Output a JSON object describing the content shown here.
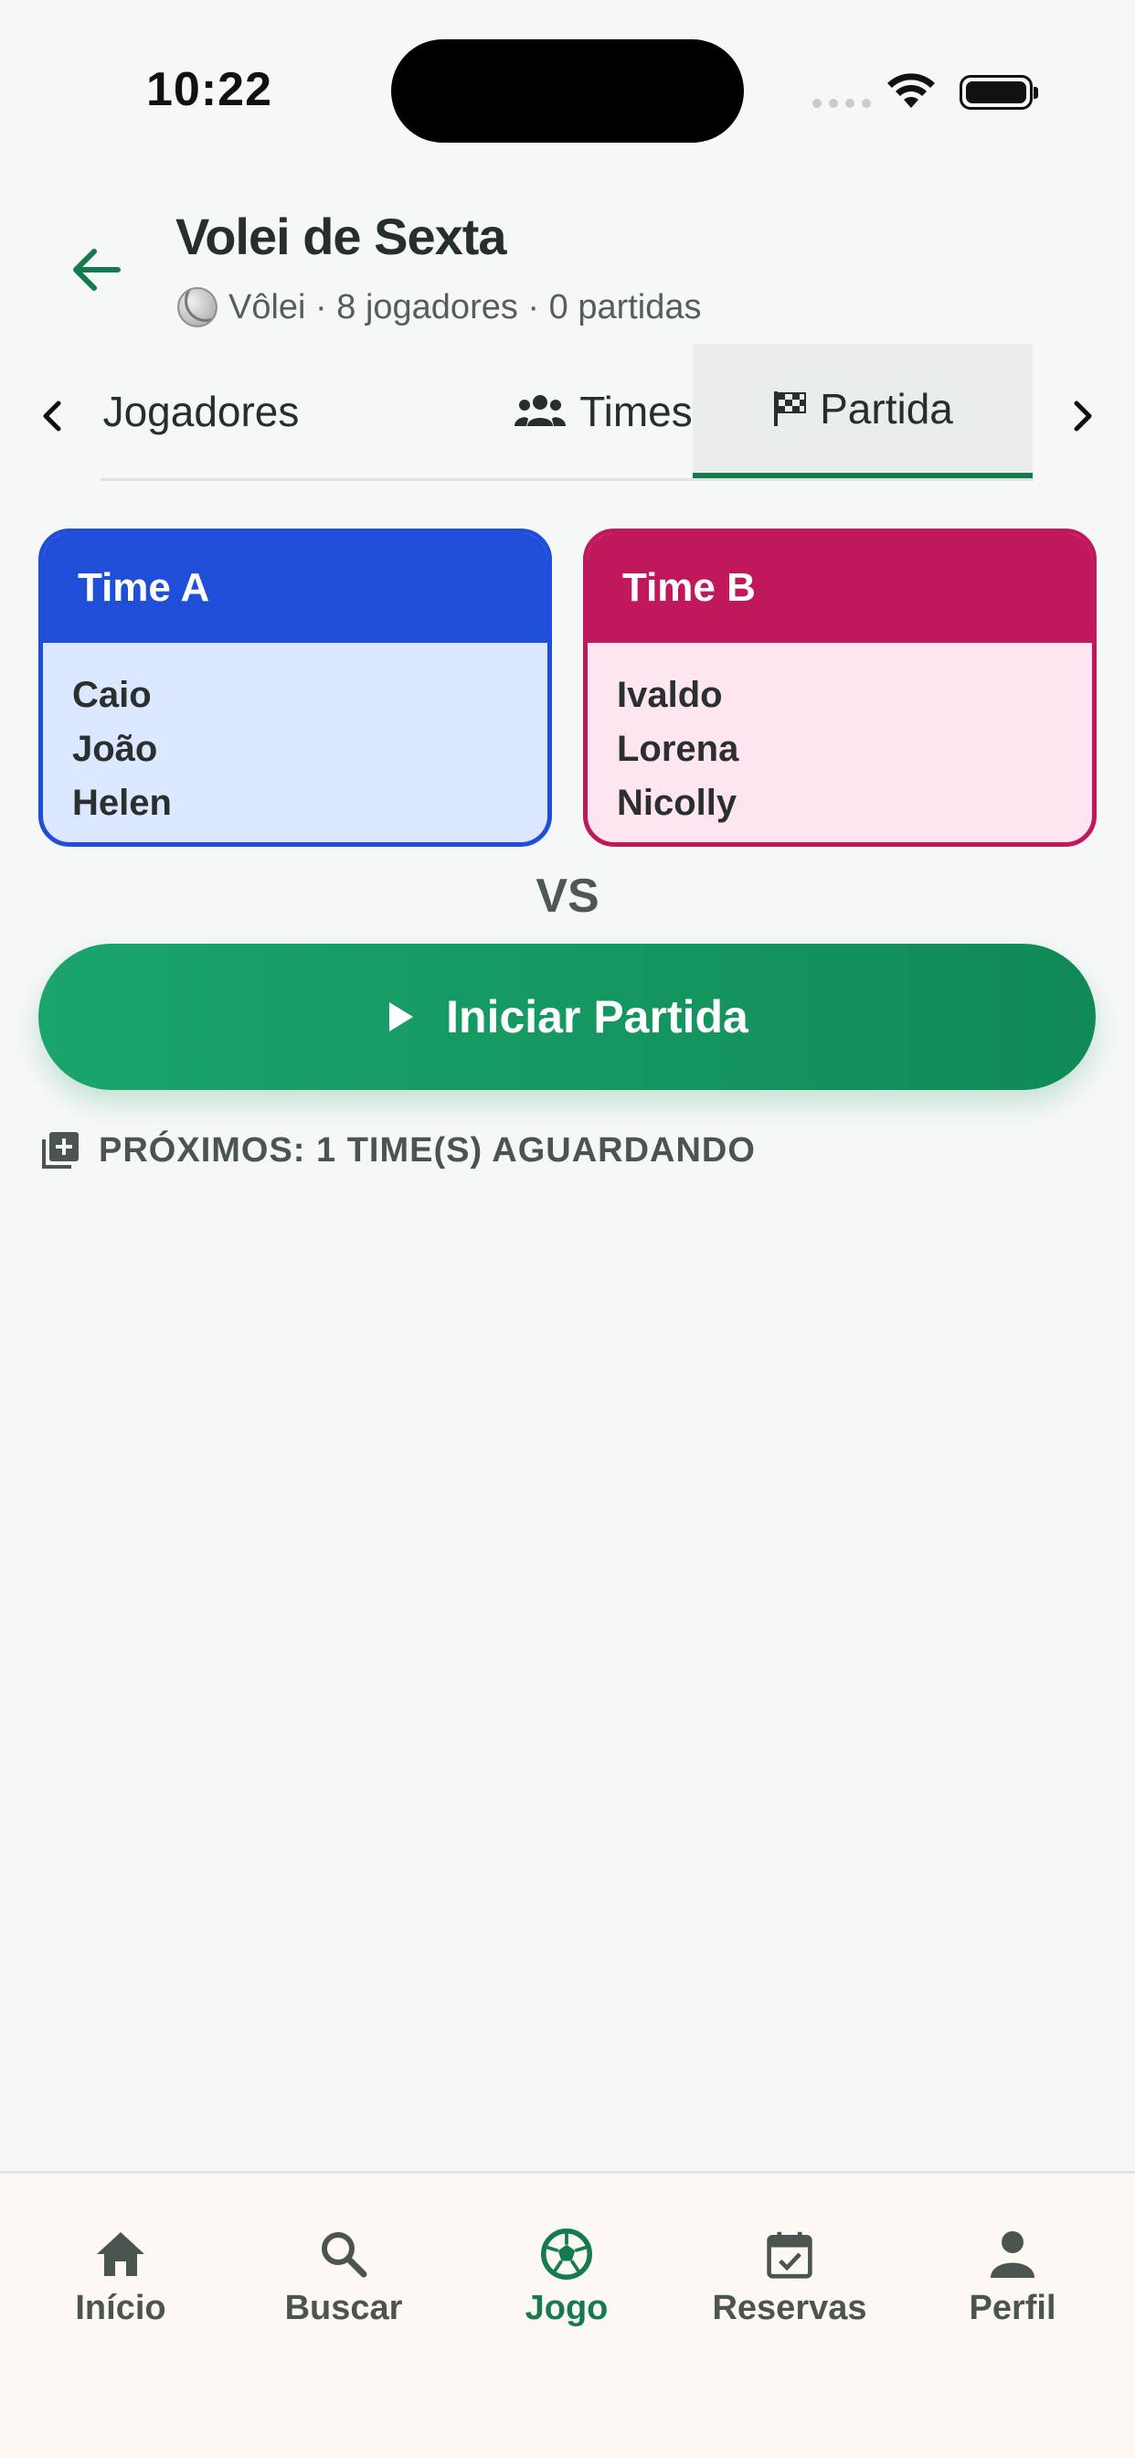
{
  "status": {
    "time": "10:22"
  },
  "header": {
    "title": "Volei de Sexta",
    "subtitle": "Vôlei · 8 jogadores · 0 partidas"
  },
  "tabs": [
    {
      "label": "Jogadores",
      "icon": "person-icon"
    },
    {
      "label": "Times",
      "icon": "group-icon"
    },
    {
      "label": "Partida",
      "icon": "checkered-flag-icon",
      "active": true
    }
  ],
  "teams": {
    "a": {
      "name": "Time A",
      "players": [
        "Caio",
        "João",
        "Helen"
      ]
    },
    "b": {
      "name": "Time B",
      "players": [
        "Ivaldo",
        "Lorena",
        "Nicolly"
      ]
    }
  },
  "vs_label": "VS",
  "start_button": {
    "label": "Iniciar Partida"
  },
  "next_teams": {
    "label": "PRÓXIMOS: 1 TIME(S) AGUARDANDO"
  },
  "nav": {
    "items": [
      {
        "label": "Início",
        "icon": "home-icon"
      },
      {
        "label": "Buscar",
        "icon": "search-icon"
      },
      {
        "label": "Jogo",
        "icon": "soccer-ball-icon",
        "active": true
      },
      {
        "label": "Reservas",
        "icon": "calendar-check-icon"
      },
      {
        "label": "Perfil",
        "icon": "person-icon"
      }
    ]
  },
  "colors": {
    "primary_green": "#157a4d",
    "team_a": "#1f4fd8",
    "team_a_bg": "#dbe8ff",
    "team_b": "#c0185a",
    "team_b_bg": "#fde6f1"
  }
}
